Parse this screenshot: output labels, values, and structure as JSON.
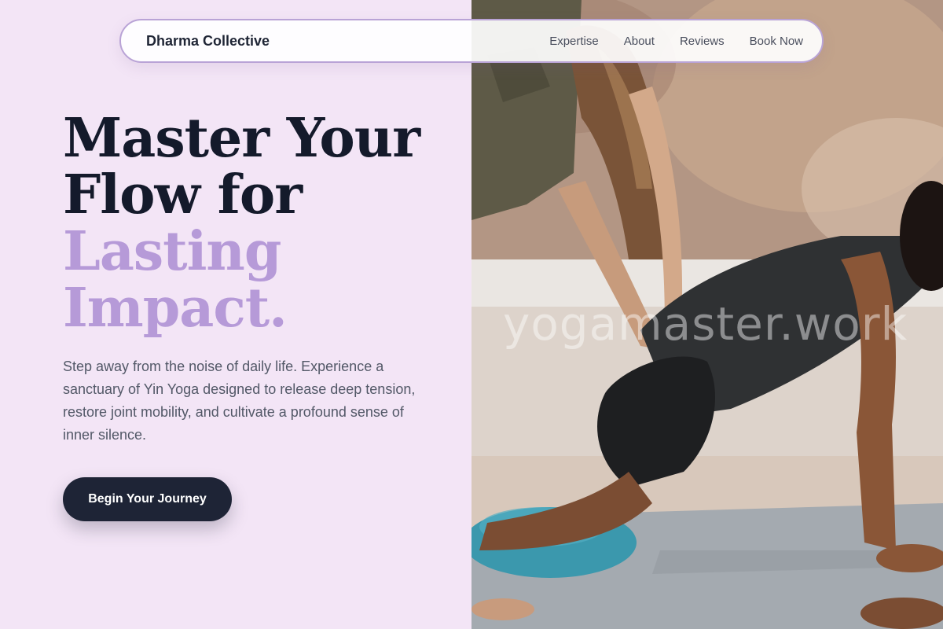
{
  "brand": "Dharma Collective",
  "nav": {
    "items": [
      {
        "label": "Expertise"
      },
      {
        "label": "About"
      },
      {
        "label": "Reviews"
      },
      {
        "label": "Book Now"
      }
    ]
  },
  "hero": {
    "title_line1": "Master Your",
    "title_line2": "Flow for",
    "title_accent1": "Lasting",
    "title_accent2": "Impact.",
    "subtitle": "Step away from the noise of daily life. Experience a sanctuary of Yin Yoga designed to release deep tension, restore joint mobility, and cultivate a profound sense of inner silence.",
    "cta_label": "Begin Your Journey"
  },
  "photo": {
    "watermark": "yogamaster.work",
    "alt": "Instructor assisting student in yoga pose"
  },
  "colors": {
    "background": "#f3e5f6",
    "accent": "#b69ad8",
    "dark": "#1e2436",
    "nav_border": "#b9a3d6"
  }
}
